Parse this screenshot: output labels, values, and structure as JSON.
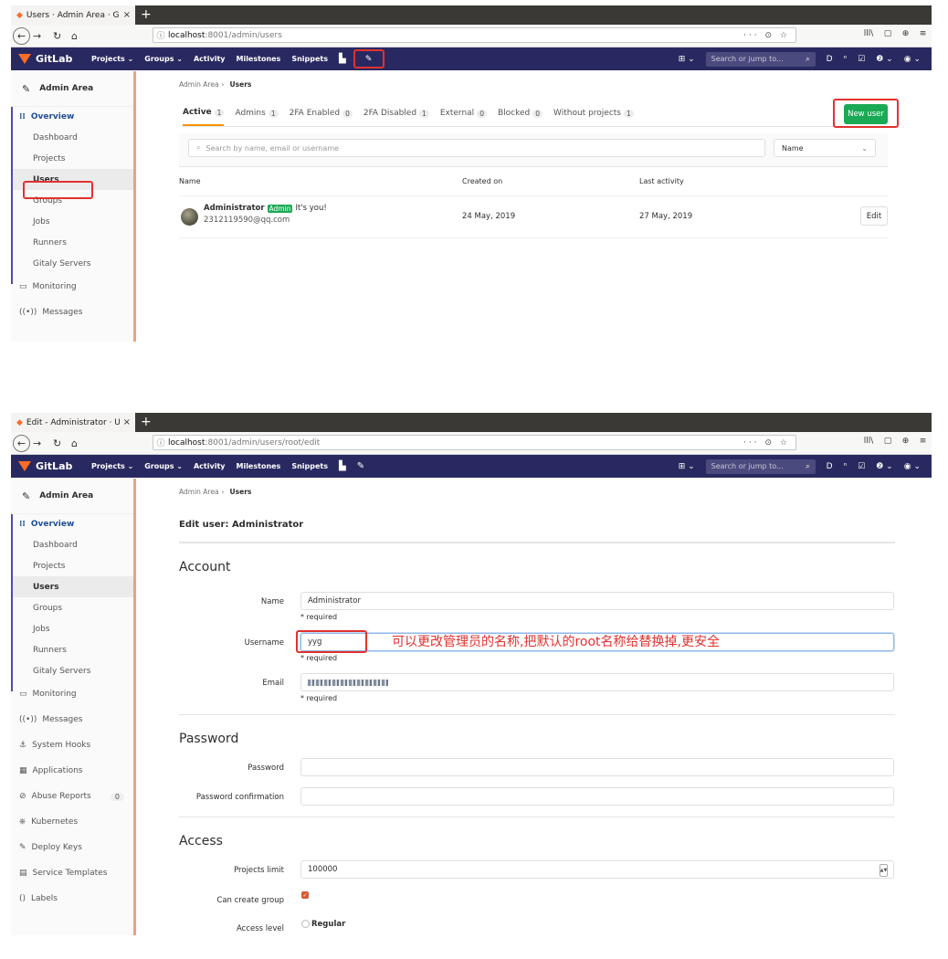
{
  "shot1": {
    "browser": {
      "tab_title": "Users · Admin Area · GitL",
      "tab_close": "×",
      "new_tab": "+",
      "url_host": "localhost",
      "url_path": ":8001/admin/users",
      "url_tools": "··· ⊙ ☆",
      "right_tools": [
        "lll\\",
        "▢",
        "⊕",
        "≡"
      ]
    },
    "gitlab_nav": {
      "brand": "GitLab",
      "menu": [
        "Projects ⌄",
        "Groups ⌄",
        "Activity",
        "Milestones",
        "Snippets"
      ],
      "search_placeholder": "Search or jump to...",
      "right_icons": [
        "⊞ ⌄",
        "D",
        "ⁿ",
        "☑",
        "❷ ⌄",
        "◉ ⌄"
      ]
    },
    "sidebar": {
      "header": "Admin Area",
      "overview": "Overview",
      "sub_items": [
        "Dashboard",
        "Projects",
        "Users",
        "Groups",
        "Jobs",
        "Runners",
        "Gitaly Servers"
      ],
      "items": [
        "Monitoring",
        "Messages"
      ]
    },
    "breadcrumb": {
      "parent": "Admin Area",
      "separator": "›",
      "current": "Users"
    },
    "tabs": [
      {
        "label": "Active",
        "count": "1"
      },
      {
        "label": "Admins",
        "count": "1"
      },
      {
        "label": "2FA Enabled",
        "count": "0"
      },
      {
        "label": "2FA Disabled",
        "count": "1"
      },
      {
        "label": "External",
        "count": "0"
      },
      {
        "label": "Blocked",
        "count": "0"
      },
      {
        "label": "Without projects",
        "count": "1"
      }
    ],
    "new_user_label": "New user",
    "search_placeholder": "Search by name, email or username",
    "sort_value": "Name",
    "table": {
      "columns": [
        "Name",
        "Created on",
        "Last activity"
      ],
      "rows": [
        {
          "name": "Administrator",
          "badge": "Admin",
          "note": "It's you!",
          "email": "2312119590@qq.com",
          "created": "24 May, 2019",
          "last_activity": "27 May, 2019",
          "action": "Edit"
        }
      ]
    }
  },
  "shot2": {
    "browser": {
      "tab_title": "Edit - Administrator · Use",
      "tab_close": "×",
      "new_tab": "+",
      "url_host": "localhost",
      "url_path": ":8001/admin/users/root/edit",
      "url_tools": "··· ⊙ ☆",
      "right_tools": [
        "lll\\",
        "▢",
        "⊕",
        "≡"
      ]
    },
    "gitlab_nav": {
      "brand": "GitLab",
      "menu": [
        "Projects ⌄",
        "Groups ⌄",
        "Activity",
        "Milestones",
        "Snippets"
      ],
      "search_placeholder": "Search or jump to...",
      "right_icons": [
        "⊞ ⌄",
        "D",
        "ⁿ",
        "☑",
        "❷ ⌄",
        "◉ ⌄"
      ]
    },
    "sidebar": {
      "header": "Admin Area",
      "overview": "Overview",
      "sub_items": [
        "Dashboard",
        "Projects",
        "Users",
        "Groups",
        "Jobs",
        "Runners",
        "Gitaly Servers"
      ],
      "items": [
        "Monitoring",
        "Messages",
        "System Hooks",
        "Applications",
        "Abuse Reports",
        "Kubernetes",
        "Deploy Keys",
        "Service Templates",
        "Labels"
      ],
      "abuse_count": "0"
    },
    "breadcrumb": {
      "parent": "Admin Area",
      "separator": "›",
      "current": "Users"
    },
    "page_title": "Edit user: Administrator",
    "sections": {
      "account": "Account",
      "password": "Password",
      "access": "Access"
    },
    "fields": {
      "name_label": "Name",
      "name_value": "Administrator",
      "username_label": "Username",
      "username_value": "yyg",
      "email_label": "Email",
      "required": "* required",
      "password_label": "Password",
      "password_confirm_label": "Password confirmation",
      "projects_limit_label": "Projects limit",
      "projects_limit_value": "100000",
      "can_create_group_label": "Can create group",
      "access_level_label": "Access level",
      "access_level_option": "Regular"
    },
    "annotation": "可以更改管理员的名称,把默认的root名称给替换掉,更安全"
  },
  "colors": {
    "nav_bg": "#292961",
    "accent_orange": "#fc6d26",
    "highlight_red": "#e0322e",
    "success_green": "#1aaa55",
    "sidebar_border": "#f0a07c"
  }
}
